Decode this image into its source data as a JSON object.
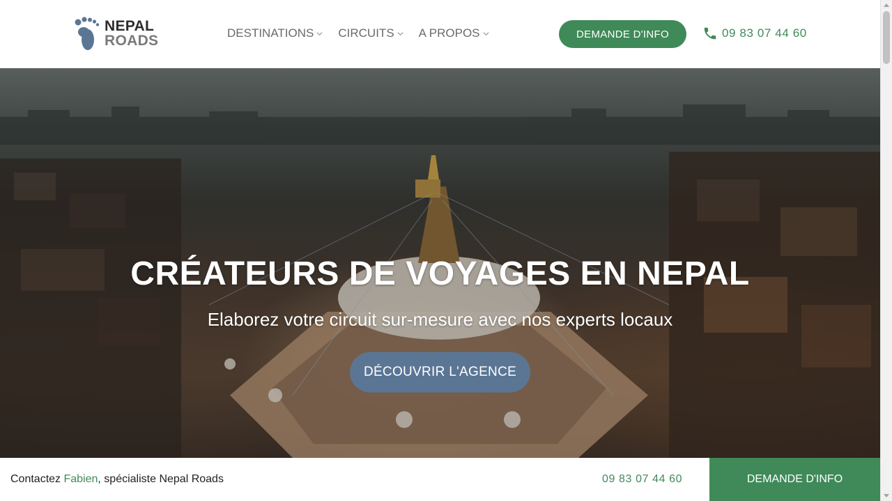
{
  "logo": {
    "line1": "NEPAL",
    "line2": "ROADS"
  },
  "nav": {
    "items": [
      {
        "label": "DESTINATIONS"
      },
      {
        "label": "CIRCUITS"
      },
      {
        "label": "A PROPOS"
      }
    ]
  },
  "header": {
    "cta_label": "DEMANDE D'INFO",
    "phone": "09 83 07 44 60"
  },
  "hero": {
    "title": "CRÉATEURS DE VOYAGES EN NEPAL",
    "subtitle": "Elaborez votre circuit sur-mesure avec nos experts locaux",
    "button_label": "DÉCOUVRIR L'AGENCE"
  },
  "bottom_bar": {
    "contact_prefix": "Contactez ",
    "contact_name": "Fabien",
    "contact_suffix": ", spécialiste Nepal Roads",
    "phone": "09 83 07 44 60",
    "cta_label": "DEMANDE D'INFO"
  },
  "colors": {
    "brand_green": "#3f8a58",
    "hero_button": "#5b7694",
    "logo_blue": "#5b7694"
  }
}
